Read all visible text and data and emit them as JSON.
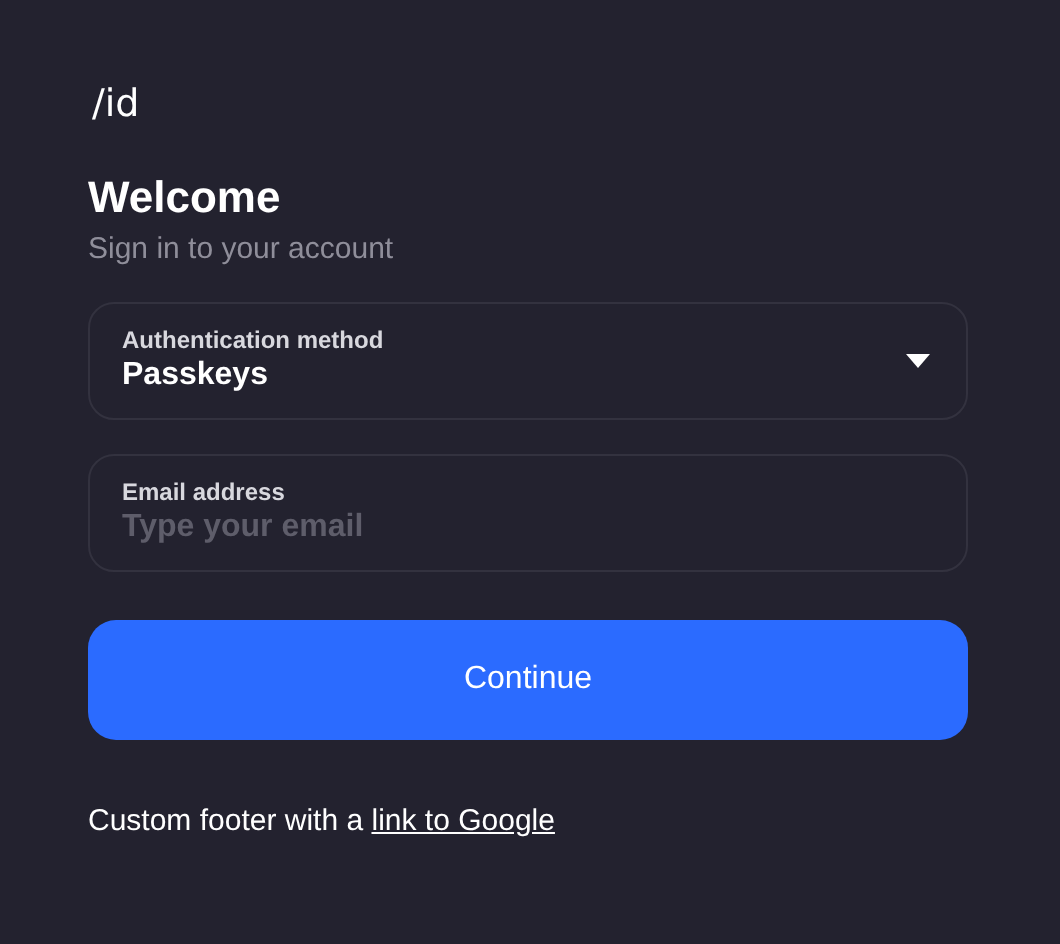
{
  "logo": "/id",
  "title": "Welcome",
  "subtitle": "Sign in to your account",
  "fields": [
    {
      "kind": "select",
      "label": "Authentication method",
      "value": "Passkeys"
    },
    {
      "kind": "text",
      "label": "Email address",
      "placeholder": "Type your email"
    }
  ],
  "button": "Continue",
  "footer": {
    "text": "Custom footer with a ",
    "link": "link to Google"
  }
}
